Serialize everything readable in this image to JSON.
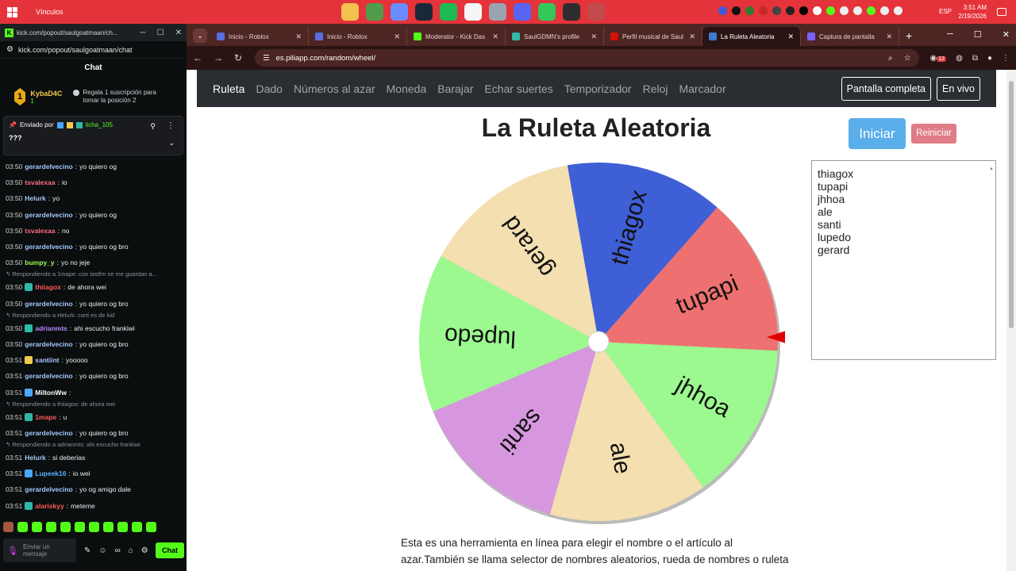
{
  "taskbar": {
    "links_label": "Vínculos",
    "language": "ESP",
    "time": "3:51 AM",
    "date": "2/19/2026"
  },
  "kick": {
    "window_url": "kick.com/popout/saulgoatmaan/ch...",
    "address": "kick.com/popout/saulgoatmaan/chat",
    "chat_title": "Chat",
    "top_gifter": {
      "rank": "1",
      "name": "KybaD4C",
      "count": "1"
    },
    "promo": "Regala 1 suscripción para tomar la posición 2",
    "pinned": {
      "sent_by": "Enviado por",
      "user": "licha_105",
      "message": "???"
    },
    "messages": [
      {
        "time": "03:50",
        "user": "gerardelvecino",
        "color": "#a6c8ff",
        "text": "yo quiero og"
      },
      {
        "time": "03:50",
        "user": "tsvalexaa",
        "color": "#ff6b81",
        "text": "io"
      },
      {
        "time": "03:50",
        "user": "Helurk",
        "color": "#a6c8ff",
        "text": "yo"
      },
      {
        "time": "03:50",
        "user": "gerardelvecino",
        "color": "#a6c8ff",
        "text": "yo quiero og"
      },
      {
        "time": "03:50",
        "user": "tsvalexaa",
        "color": "#ff6b81",
        "text": "no"
      },
      {
        "time": "03:50",
        "user": "gerardelvecino",
        "color": "#a6c8ff",
        "text": "yo quiero og bro"
      },
      {
        "time": "03:50",
        "user": "bumpy_y",
        "color": "#9cff57",
        "text": "yo no jeje"
      },
      {
        "reply": "Respondiendo a 1mape: con lastfm se me guardan a..."
      },
      {
        "time": "03:50",
        "user": "thiiagox",
        "color": "#ff5a5a",
        "text": "de ahora wei"
      },
      {
        "time": "03:50",
        "user": "gerardelvecino",
        "color": "#a6c8ff",
        "text": "yo quiero og bro"
      },
      {
        "reply": "Respondiendo a Helurk: carti es de kid"
      },
      {
        "time": "03:50",
        "user": "adrianmts",
        "color": "#b388ff",
        "text": "ahi escucho frankiwi"
      },
      {
        "time": "03:50",
        "user": "gerardelvecino",
        "color": "#a6c8ff",
        "text": "yo quiero og bro"
      },
      {
        "time": "03:51",
        "user": "santiint",
        "color": "#a6c8ff",
        "text": "yooooo"
      },
      {
        "time": "03:51",
        "user": "gerardelvecino",
        "color": "#a6c8ff",
        "text": "yo quiero og bro"
      },
      {
        "time": "03:51",
        "user": "MiltonWw",
        "color": "#ffffff",
        "text": ""
      },
      {
        "reply": "Respondiendo a thiiagox: de ahora wei"
      },
      {
        "time": "03:51",
        "user": "1mape",
        "color": "#ff5a5a",
        "text": "u"
      },
      {
        "time": "03:51",
        "user": "gerardelvecino",
        "color": "#a6c8ff",
        "text": "yo quiero og bro"
      },
      {
        "reply": "Respondiendo a adrianmts: ahi escucho frankiwi"
      },
      {
        "time": "03:51",
        "user": "Helurk",
        "color": "#a6c8ff",
        "text": "si deberias"
      },
      {
        "time": "03:51",
        "user": "Lupeek16",
        "color": "#5ab0ff",
        "text": "io wei"
      },
      {
        "time": "03:51",
        "user": "gerardelvecino",
        "color": "#a6c8ff",
        "text": "yo og amigo dale"
      },
      {
        "time": "03:51",
        "user": "alariskyy",
        "color": "#ff5a5a",
        "text": "meteme"
      }
    ],
    "input_placeholder": "Enviar un mensaje",
    "send_label": "Chat"
  },
  "chrome": {
    "tabs": [
      {
        "title": "Inicio - Roblox",
        "color": "#5b6ee1"
      },
      {
        "title": "Inicio - Roblox",
        "color": "#5b6ee1"
      },
      {
        "title": "Moderator - Kick Das",
        "color": "#53fc18"
      },
      {
        "title": "SaulGDMN's profile",
        "color": "#2fb8a8"
      },
      {
        "title": "Perfil musical de Saul",
        "color": "#d51007"
      },
      {
        "title": "La Ruleta Aleatoria",
        "color": "#3a7bd5"
      },
      {
        "title": "Captura de pantalla",
        "color": "#7b61ff"
      }
    ],
    "url": "es.piliapp.com/random/wheel/",
    "ext_badge": "12"
  },
  "site": {
    "nav": [
      "Ruleta",
      "Dado",
      "Números al azar",
      "Moneda",
      "Barajar",
      "Echar suertes",
      "Temporizador",
      "Reloj",
      "Marcador"
    ],
    "fullscreen": "Pantalla completa",
    "live": "En vivo",
    "title": "La Ruleta Aleatoria",
    "start": "Iniciar",
    "reset": "Reiniciar",
    "names_text": "thiagox\ntupapi\njhhoa\nale\nsanti\nlupedo\ngerard",
    "description": "Esta es una herramienta en línea para elegir el nombre o el artículo al azar.También se llama selector de nombres aleatorios, rueda de nombres o ruleta en línea.A"
  },
  "wheel": {
    "segments": [
      {
        "name": "thiagox",
        "color": "#3f5fd6"
      },
      {
        "name": "tupapi",
        "color": "#ef7070"
      },
      {
        "name": "jhhoa",
        "color": "#9cf98f"
      },
      {
        "name": "ale",
        "color": "#f3dfb0"
      },
      {
        "name": "santi",
        "color": "#d797de"
      },
      {
        "name": "lupedo",
        "color": "#9cf98f"
      },
      {
        "name": "gerard",
        "color": "#f3dfb0"
      }
    ],
    "pointer_color": "#e00000"
  }
}
